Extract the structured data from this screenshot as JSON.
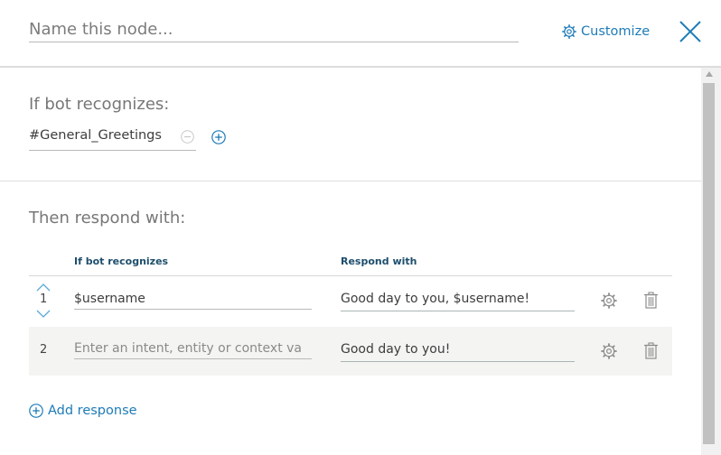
{
  "header": {
    "name_placeholder": "Name this node...",
    "customize_label": "Customize"
  },
  "conditions": {
    "title": "If bot recognizes:",
    "value": "#General_Greetings"
  },
  "responses": {
    "title": "Then respond with:",
    "col_condition": "If bot recognizes",
    "col_response": "Respond with",
    "rows": [
      {
        "index": "1",
        "condition": "$username",
        "response": "Good day to you, $username!"
      },
      {
        "index": "2",
        "condition": "",
        "condition_placeholder": "Enter an intent, entity or context va",
        "response": "Good day to you!"
      }
    ],
    "add_label": "Add response"
  },
  "colors": {
    "accent": "#1e7bb8",
    "header_text": "#1d4e6c",
    "row_alt": "#f4f4f2"
  }
}
